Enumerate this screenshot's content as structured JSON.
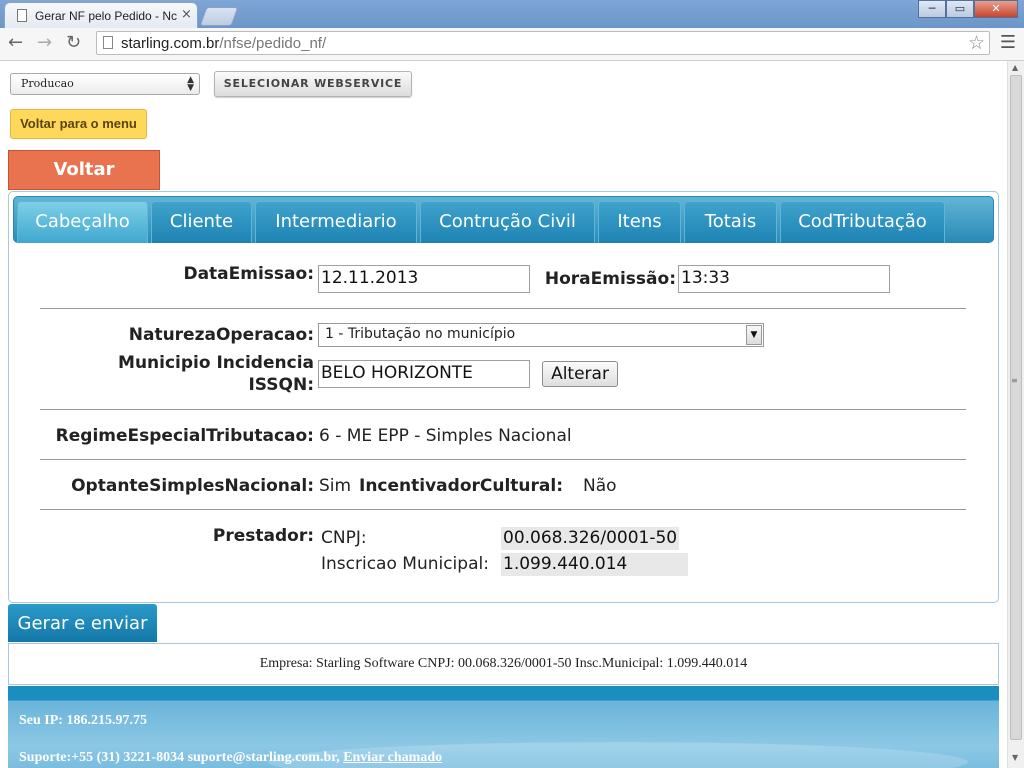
{
  "browser": {
    "tab_title": "Gerar NF pelo Pedido - Nc",
    "tab_close": "×",
    "url_host": "starling.com.br",
    "url_path": "/nfse/pedido_nf/",
    "icons": [
      "back-icon",
      "forward-icon",
      "reload-icon",
      "star-icon",
      "menu-icon"
    ],
    "win_controls": {
      "minimize": "─",
      "maximize": "▭",
      "close": "✕"
    }
  },
  "webservice": {
    "selected": "Producao",
    "button_label": "SELECIONAR WEBSERVICE"
  },
  "menu_button": "Voltar para o menu",
  "back_button": "Voltar",
  "tabs": [
    "Cabeçalho",
    "Cliente",
    "Intermediario",
    "Contrução Civil",
    "Itens",
    "Totais",
    "CodTributação"
  ],
  "active_tab": "Cabeçalho",
  "colors": {
    "accent": "#2a8ab6",
    "back": "#e9734f",
    "menu": "#fed85a"
  },
  "form": {
    "data_emissao_label": "DataEmissao:",
    "data_emissao_value": "12.11.2013",
    "hora_emissao_label": "HoraEmissão:",
    "hora_emissao_value": "13:33",
    "natureza_label": "NaturezaOperacao:",
    "natureza_value": "1 - Tributação no município",
    "municipio_label_1": "Municipio Incidencia",
    "municipio_label_2": "ISSQN:",
    "municipio_value": "BELO HORIZONTE",
    "alterar_label": "Alterar",
    "regime_label": "RegimeEspecialTributacao:",
    "regime_value": "6 - ME EPP - Simples Nacional",
    "optante_label": "OptanteSimplesNacional:",
    "optante_value": "Sim",
    "incentivador_label": "IncentivadorCultural:",
    "incentivador_value": "Não",
    "prestador_label": "Prestador:",
    "cnpj_label": "CNPJ:",
    "cnpj_value": "00.068.326/0001-50",
    "inscricao_label": "Inscricao Municipal:",
    "inscricao_value": "1.099.440.014"
  },
  "gerar_button": "Gerar e enviar",
  "empresa_text": "Empresa: Starling Software CNPJ: 00.068.326/0001-50 Insc.Municipal: 1.099.440.014",
  "footer": {
    "ip": "Seu IP: 186.215.97.75",
    "support_prefix": "Suporte:+55 (31) 3221-8034 suporte@starling.com.br, ",
    "support_link": "Enviar chamado"
  }
}
